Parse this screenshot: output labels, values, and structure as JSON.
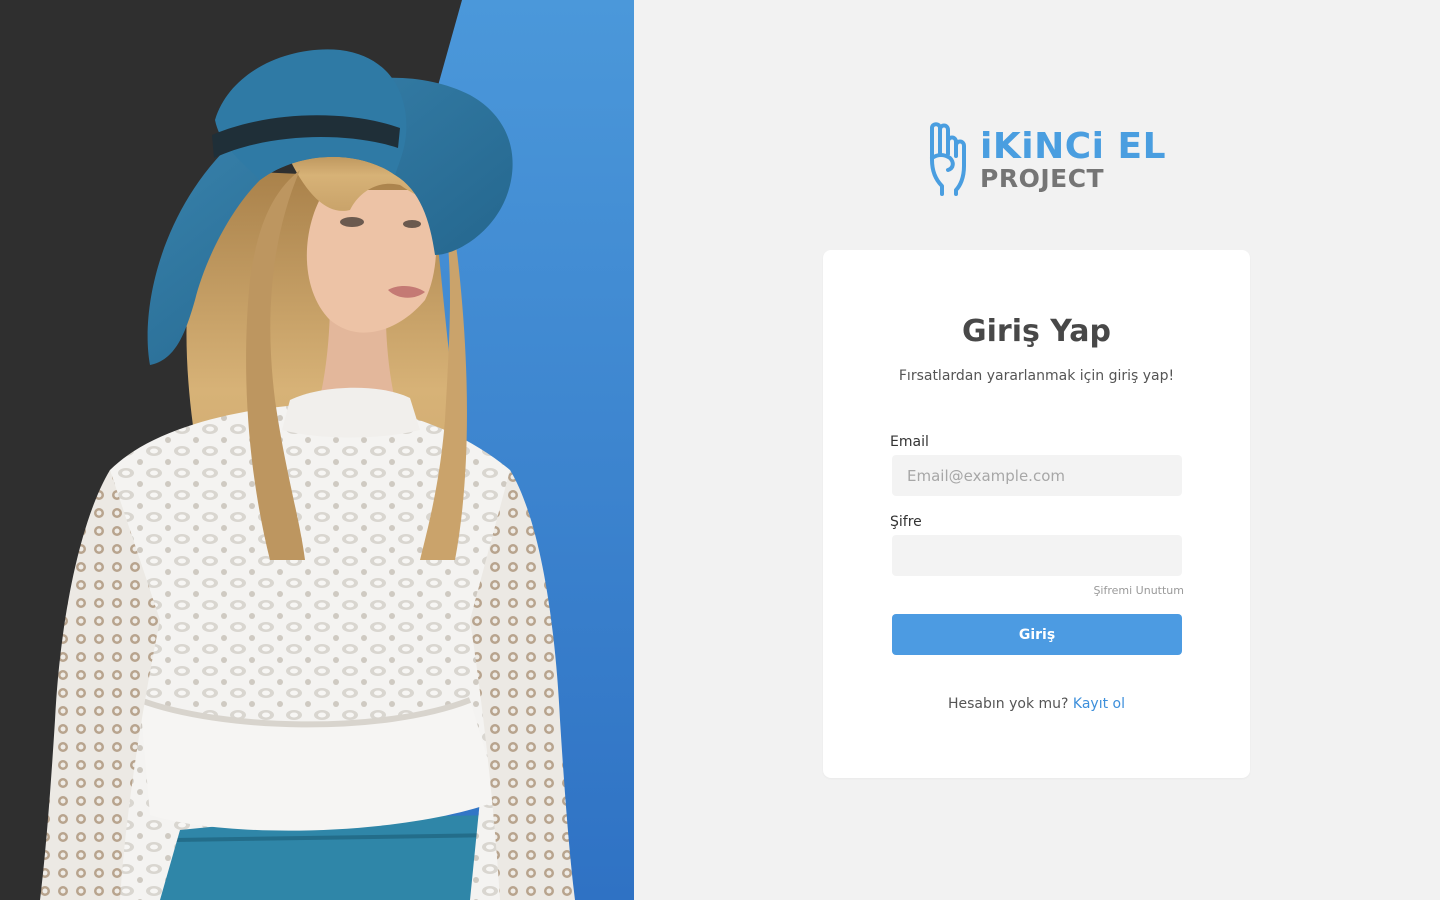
{
  "brand": {
    "line1": "iKiNCi EL",
    "line2": "PROJECT",
    "accent_color": "#4a9ee0",
    "secondary_color": "#757575"
  },
  "login": {
    "title": "Giriş Yap",
    "subtitle": "Fırsatlardan yararlanmak için giriş yap!",
    "email_label": "Email",
    "email_placeholder": "Email@example.com",
    "email_value": "",
    "password_label": "Şifre",
    "password_value": "",
    "forgot_label": "Şifremi Unuttum",
    "submit_label": "Giriş",
    "signup_prompt": "Hesabın yok mu?",
    "signup_link": "Kayıt ol",
    "button_color": "#4c9be2"
  },
  "hero": {
    "image": "woman-in-blue-hat-photo",
    "bg_dark": "#2f2f2f",
    "bg_blue": "#3f8fd6"
  }
}
